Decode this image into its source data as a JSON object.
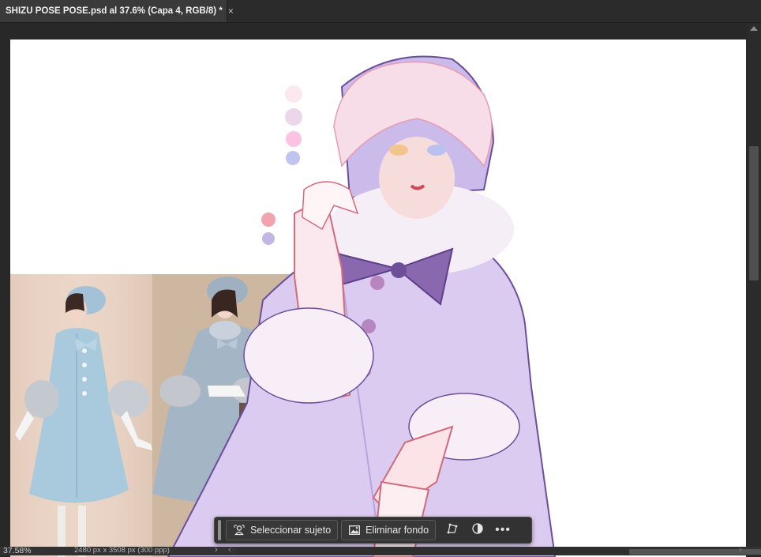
{
  "document_tab": {
    "title": "SHIZU POSE POSE.psd al 37.6% (Capa 4, RGB/8) *",
    "close_glyph": "×"
  },
  "status_bar": {
    "zoom": "37.58%",
    "doc_size": "2480 px x 3508 px (300 ppp)",
    "chevron": "›",
    "scroll_left": "‹",
    "scroll_right": "›"
  },
  "taskbar": {
    "select_subject_label": "Seleccionar sujeto",
    "select_subject_icon": "person-select-icon",
    "remove_bg_label": "Eliminar fondo",
    "remove_bg_icon": "image-icon",
    "transform_icon": "transform-icon",
    "adjust_icon": "contrast-icon",
    "more_icon": "more-icon",
    "more_glyph": "•••"
  },
  "canvas": {
    "palette_swatches": [
      "#fce9f0",
      "#ecd7ea",
      "#fbc2e1",
      "#bfc5ef",
      "#f2a3ad",
      "#c3b7e2"
    ],
    "photo_colors": {
      "coat": "#a9c9dc",
      "backdrop1": "#e9d3c4",
      "backdrop2": "#cdb7a0",
      "coat2": "#a4b5c6"
    },
    "art_colors": {
      "coat": "#dccbf0",
      "hair": "#f6dde8",
      "fur": "#f6eef6",
      "bow": "#8a68b0",
      "outline": "#6a4f9a"
    }
  }
}
